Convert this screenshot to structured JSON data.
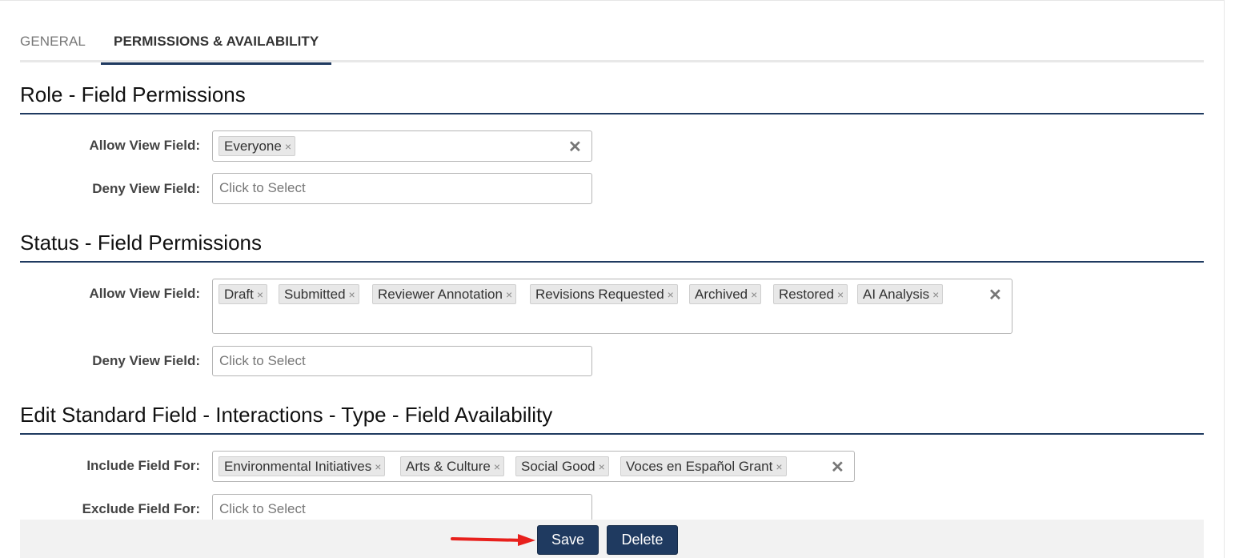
{
  "tabs": [
    {
      "label": "GENERAL"
    },
    {
      "label": "PERMISSIONS & AVAILABILITY"
    }
  ],
  "sections": {
    "role": {
      "title": "Role - Field Permissions",
      "allow_label": "Allow View Field:",
      "allow_tags": [
        "Everyone"
      ],
      "deny_label": "Deny View Field:",
      "deny_placeholder": "Click to Select"
    },
    "status": {
      "title": "Status - Field Permissions",
      "allow_label": "Allow View Field:",
      "allow_tags": [
        "Draft",
        "Submitted",
        "Reviewer Annotation",
        "Revisions Requested",
        "Archived",
        "Restored",
        "AI Analysis"
      ],
      "deny_label": "Deny View Field:",
      "deny_placeholder": "Click to Select"
    },
    "availability": {
      "title": "Edit Standard Field - Interactions - Type - Field Availability",
      "include_label": "Include Field For:",
      "include_tags": [
        "Environmental Initiatives",
        "Arts & Culture",
        "Social Good",
        "Voces en Español Grant"
      ],
      "exclude_label": "Exclude Field For:",
      "exclude_placeholder": "Click to Select"
    }
  },
  "icons": {
    "tag_remove": "×",
    "clear_all": "✕"
  },
  "footer": {
    "save_label": "Save",
    "delete_label": "Delete"
  },
  "colors": {
    "primary": "#1f3a60",
    "annotation_arrow": "#e8201c"
  }
}
